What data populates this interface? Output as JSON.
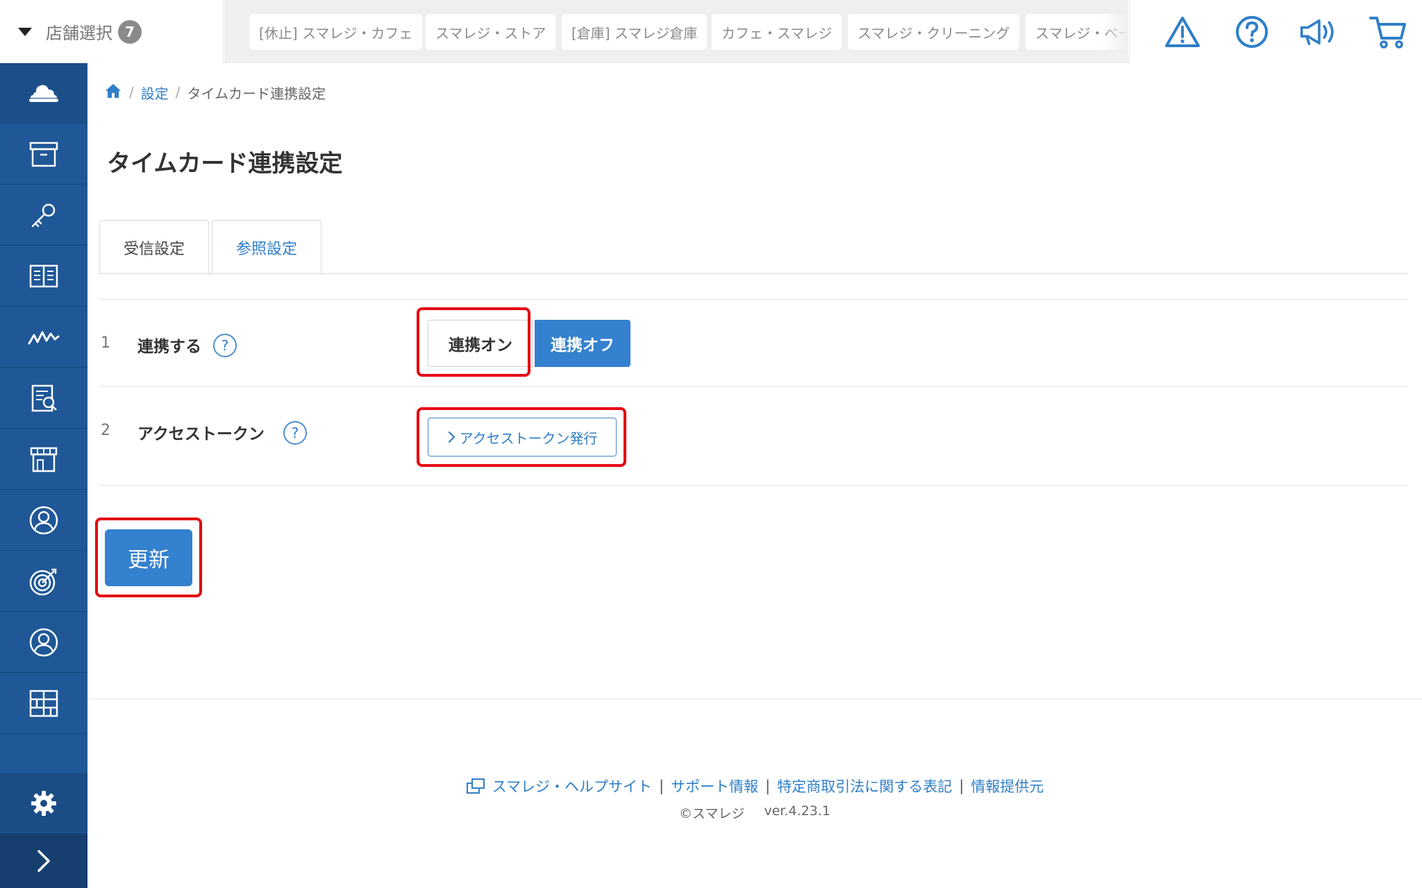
{
  "topbar": {
    "store_select_label": "店舗選択",
    "store_count": "7",
    "store_tabs": [
      "[休止] スマレジ・カフェ",
      "スマレジ・ストア",
      "[倉庫] スマレジ倉庫",
      "カフェ・スマレジ",
      "スマレジ・クリーニング",
      "スマレジ・ベー"
    ],
    "icons": [
      "warning-icon",
      "help-icon",
      "megaphone-icon",
      "cart-icon"
    ]
  },
  "sidebar": {
    "items": [
      "cloud-icon",
      "archive-icon",
      "key-icon",
      "book-icon",
      "chart-icon",
      "report-icon",
      "store-icon",
      "customer-icon",
      "target-icon",
      "staff-icon",
      "grid-icon"
    ],
    "bottom": [
      "gear-icon",
      "chevron-right-icon"
    ]
  },
  "breadcrumb": {
    "home": "home-icon",
    "items": [
      "設定",
      "タイムカード連携設定"
    ]
  },
  "page": {
    "title": "タイムカード連携設定",
    "tabs": [
      "受信設定",
      "参照設定"
    ],
    "rows": [
      {
        "num": "1",
        "label": "連携する",
        "help": "?",
        "toggle_on": "連携オン",
        "toggle_off": "連携オフ",
        "selected": "連携オフ"
      },
      {
        "num": "2",
        "label": "アクセストークン",
        "help": "?",
        "button": "アクセストークン発行"
      }
    ],
    "update_button": "更新"
  },
  "footer": {
    "links": [
      "スマレジ・ヘルプサイト",
      "サポート情報",
      "特定商取引法に関する表記",
      "情報提供元"
    ],
    "separator": "|",
    "copyright": "©スマレジ",
    "version": "ver.4.23.1"
  },
  "colors": {
    "sidebar": "#1f5797",
    "accent": "#3481cf",
    "link": "#2f7fc8",
    "highlight": "#e60012"
  }
}
